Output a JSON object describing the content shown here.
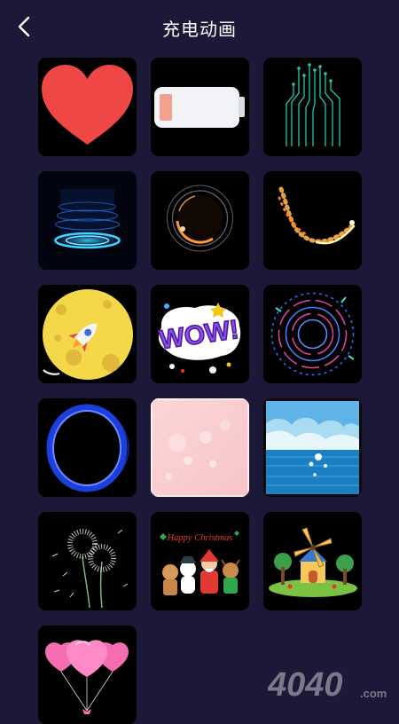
{
  "header": {
    "title": "充电动画",
    "back_icon": "chevron-left-icon"
  },
  "animations": [
    {
      "name": "heart",
      "icon": "heart-icon"
    },
    {
      "name": "battery",
      "icon": "battery-icon"
    },
    {
      "name": "circuit",
      "icon": "circuit-icon"
    },
    {
      "name": "hologram-portal",
      "icon": "hologram-icon"
    },
    {
      "name": "eclipse-ring",
      "icon": "eclipse-icon"
    },
    {
      "name": "spark-trail",
      "icon": "sparkle-icon"
    },
    {
      "name": "moon-rocket",
      "icon": "rocket-icon"
    },
    {
      "name": "wow",
      "icon": "wow-sticker-icon",
      "text": "WOW!"
    },
    {
      "name": "neon-rings",
      "icon": "rings-icon"
    },
    {
      "name": "blue-ring",
      "icon": "ring-icon"
    },
    {
      "name": "pink-bokeh",
      "icon": "bokeh-icon"
    },
    {
      "name": "sea-clouds",
      "icon": "sea-icon"
    },
    {
      "name": "dandelion",
      "icon": "dandelion-icon"
    },
    {
      "name": "happy-christmas",
      "icon": "christmas-icon",
      "text": "Happy Christmas"
    },
    {
      "name": "windmill",
      "icon": "windmill-icon"
    },
    {
      "name": "heart-balloons",
      "icon": "balloon-icon"
    }
  ],
  "watermark": {
    "text": "4040",
    "suffix": ".com"
  },
  "colors": {
    "background": "#1b1838",
    "tile": "#000000",
    "title": "#ffffff"
  }
}
